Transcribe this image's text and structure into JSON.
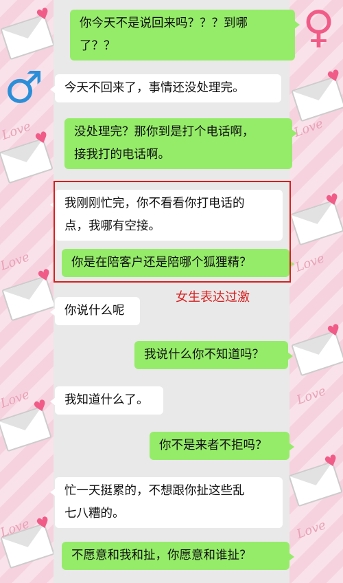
{
  "background": {
    "decoration_text": "Love",
    "colors": {
      "pink": "#f6d2df",
      "heart": "#f05c87",
      "stripe": "#e9e9e9"
    }
  },
  "icons": {
    "female": "female-symbol-icon",
    "male": "male-symbol-icon"
  },
  "colors": {
    "my_bubble": "#95ec69",
    "their_bubble": "#ffffff",
    "highlight": "#d81e1e"
  },
  "messages": [
    {
      "side": "me",
      "lines": [
        "你今天不是说回来吗？？？到哪",
        "了？？"
      ]
    },
    {
      "side": "them",
      "lines": [
        "今天不回来了，事情还没处理完。"
      ]
    },
    {
      "side": "me",
      "lines": [
        "没处理完？那你到是打个电话啊，",
        "接我打的电话啊。"
      ]
    },
    {
      "side": "them",
      "lines": [
        "我刚刚忙完，你不看看你打电话的",
        "点，我哪有空接。"
      ]
    },
    {
      "side": "me",
      "lines": [
        "你是在陪客户还是陪哪个狐狸精？"
      ]
    },
    {
      "side": "them",
      "lines": [
        "你说什么呢"
      ]
    },
    {
      "side": "me",
      "lines": [
        "我说什么你不知道吗？"
      ]
    },
    {
      "side": "them",
      "lines": [
        "我知道什么了。"
      ]
    },
    {
      "side": "me",
      "lines": [
        "你不是来者不拒吗？"
      ]
    },
    {
      "side": "them",
      "lines": [
        "忙一天挺累的，不想跟你扯这些乱",
        "七八糟的。"
      ]
    },
    {
      "side": "me",
      "lines": [
        "不愿意和我和扯，你愿意和谁扯？"
      ]
    }
  ],
  "annotation": "女生表达过激"
}
